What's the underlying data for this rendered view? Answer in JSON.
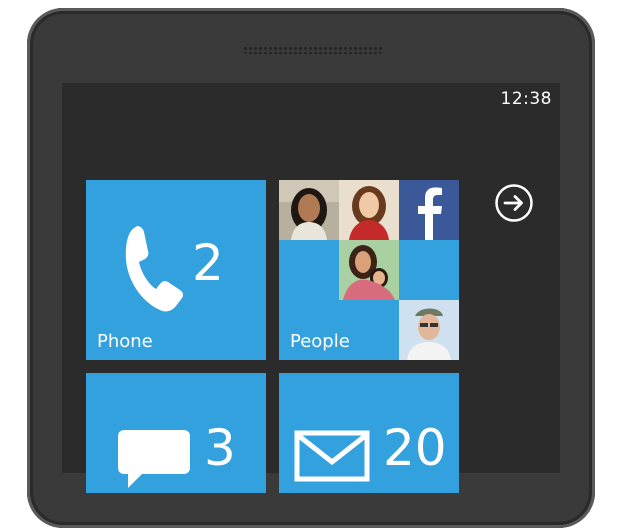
{
  "status_bar": {
    "time": "12:38"
  },
  "tiles": {
    "phone": {
      "label": "Phone",
      "count": "2",
      "icon": "phone-icon"
    },
    "people": {
      "label": "People",
      "icon": "facebook-icon"
    },
    "messaging": {
      "count": "3",
      "icon": "speech-bubble-icon"
    },
    "email": {
      "count": "20",
      "icon": "envelope-icon"
    }
  },
  "navigation": {
    "icon": "arrow-right-circle-icon"
  },
  "colors": {
    "accent": "#33a1dd",
    "screen_background": "#2b2b2b",
    "phone_frame": "#3a3a3a",
    "facebook": "#3b5998"
  }
}
